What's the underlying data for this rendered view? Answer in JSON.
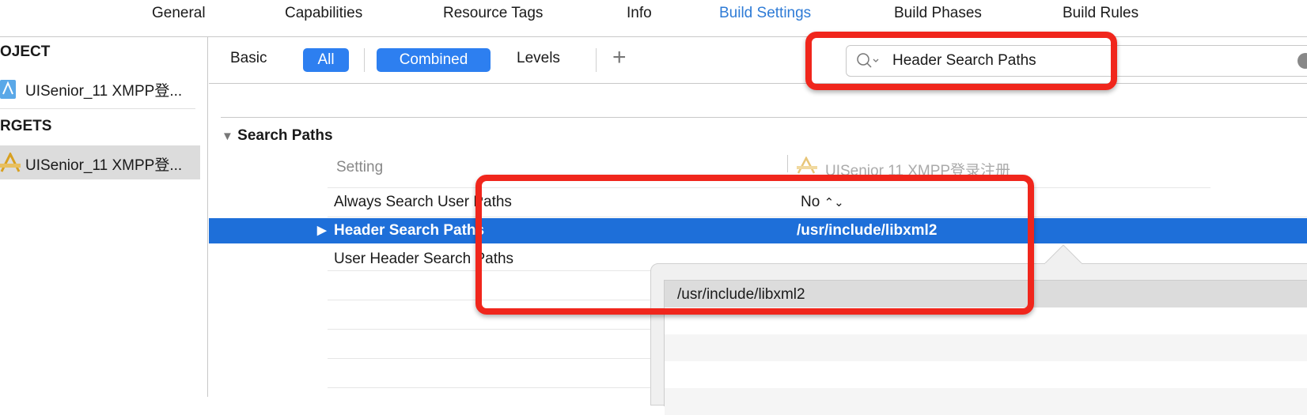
{
  "tabs": [
    {
      "label": "General"
    },
    {
      "label": "Capabilities"
    },
    {
      "label": "Resource Tags"
    },
    {
      "label": "Info"
    },
    {
      "label": "Build Settings",
      "active": true
    },
    {
      "label": "Build Phases"
    },
    {
      "label": "Build Rules"
    }
  ],
  "sidebar": {
    "project_header": "OJECT",
    "project_item": "UISenior_11 XMPP登...",
    "targets_header": "RGETS",
    "target_item": "UISenior_11 XMPP登..."
  },
  "toolbar": {
    "basic": "Basic",
    "all": "All",
    "combined": "Combined",
    "levels": "Levels",
    "add": "+"
  },
  "search": {
    "value": "Header Search Paths"
  },
  "section": {
    "title": "Search Paths",
    "col_setting": "Setting",
    "col_target": "UISenior 11 XMPP登录注册"
  },
  "rows": [
    {
      "name": "Always Search User Paths",
      "value": "No"
    },
    {
      "name": "Header Search Paths",
      "value": "/usr/include/libxml2"
    },
    {
      "name": "User Header Search Paths",
      "value": ""
    }
  ],
  "popover": {
    "items": [
      "/usr/include/libxml2"
    ]
  },
  "colors": {
    "accent": "#2d7ff0",
    "selection": "#1e6fd9",
    "annotation": "#f0261c"
  }
}
